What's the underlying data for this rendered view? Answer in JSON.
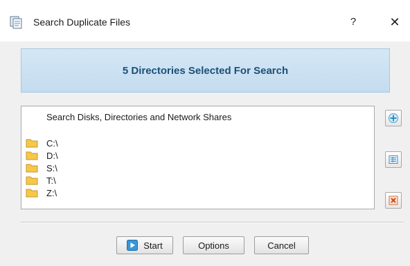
{
  "window": {
    "title": "Search Duplicate Files",
    "help_glyph": "?",
    "close_glyph": "✕"
  },
  "banner": {
    "text": "5 Directories Selected For Search"
  },
  "list": {
    "header": "Search Disks, Directories and Network Shares",
    "items": [
      "C:\\",
      "D:\\",
      "S:\\",
      "T:\\",
      "Z:\\"
    ]
  },
  "side_buttons": {
    "add_icon": "plus-icon",
    "edit_icon": "list-edit-icon",
    "remove_icon": "remove-icon"
  },
  "buttons": {
    "start": "Start",
    "options": "Options",
    "cancel": "Cancel"
  }
}
